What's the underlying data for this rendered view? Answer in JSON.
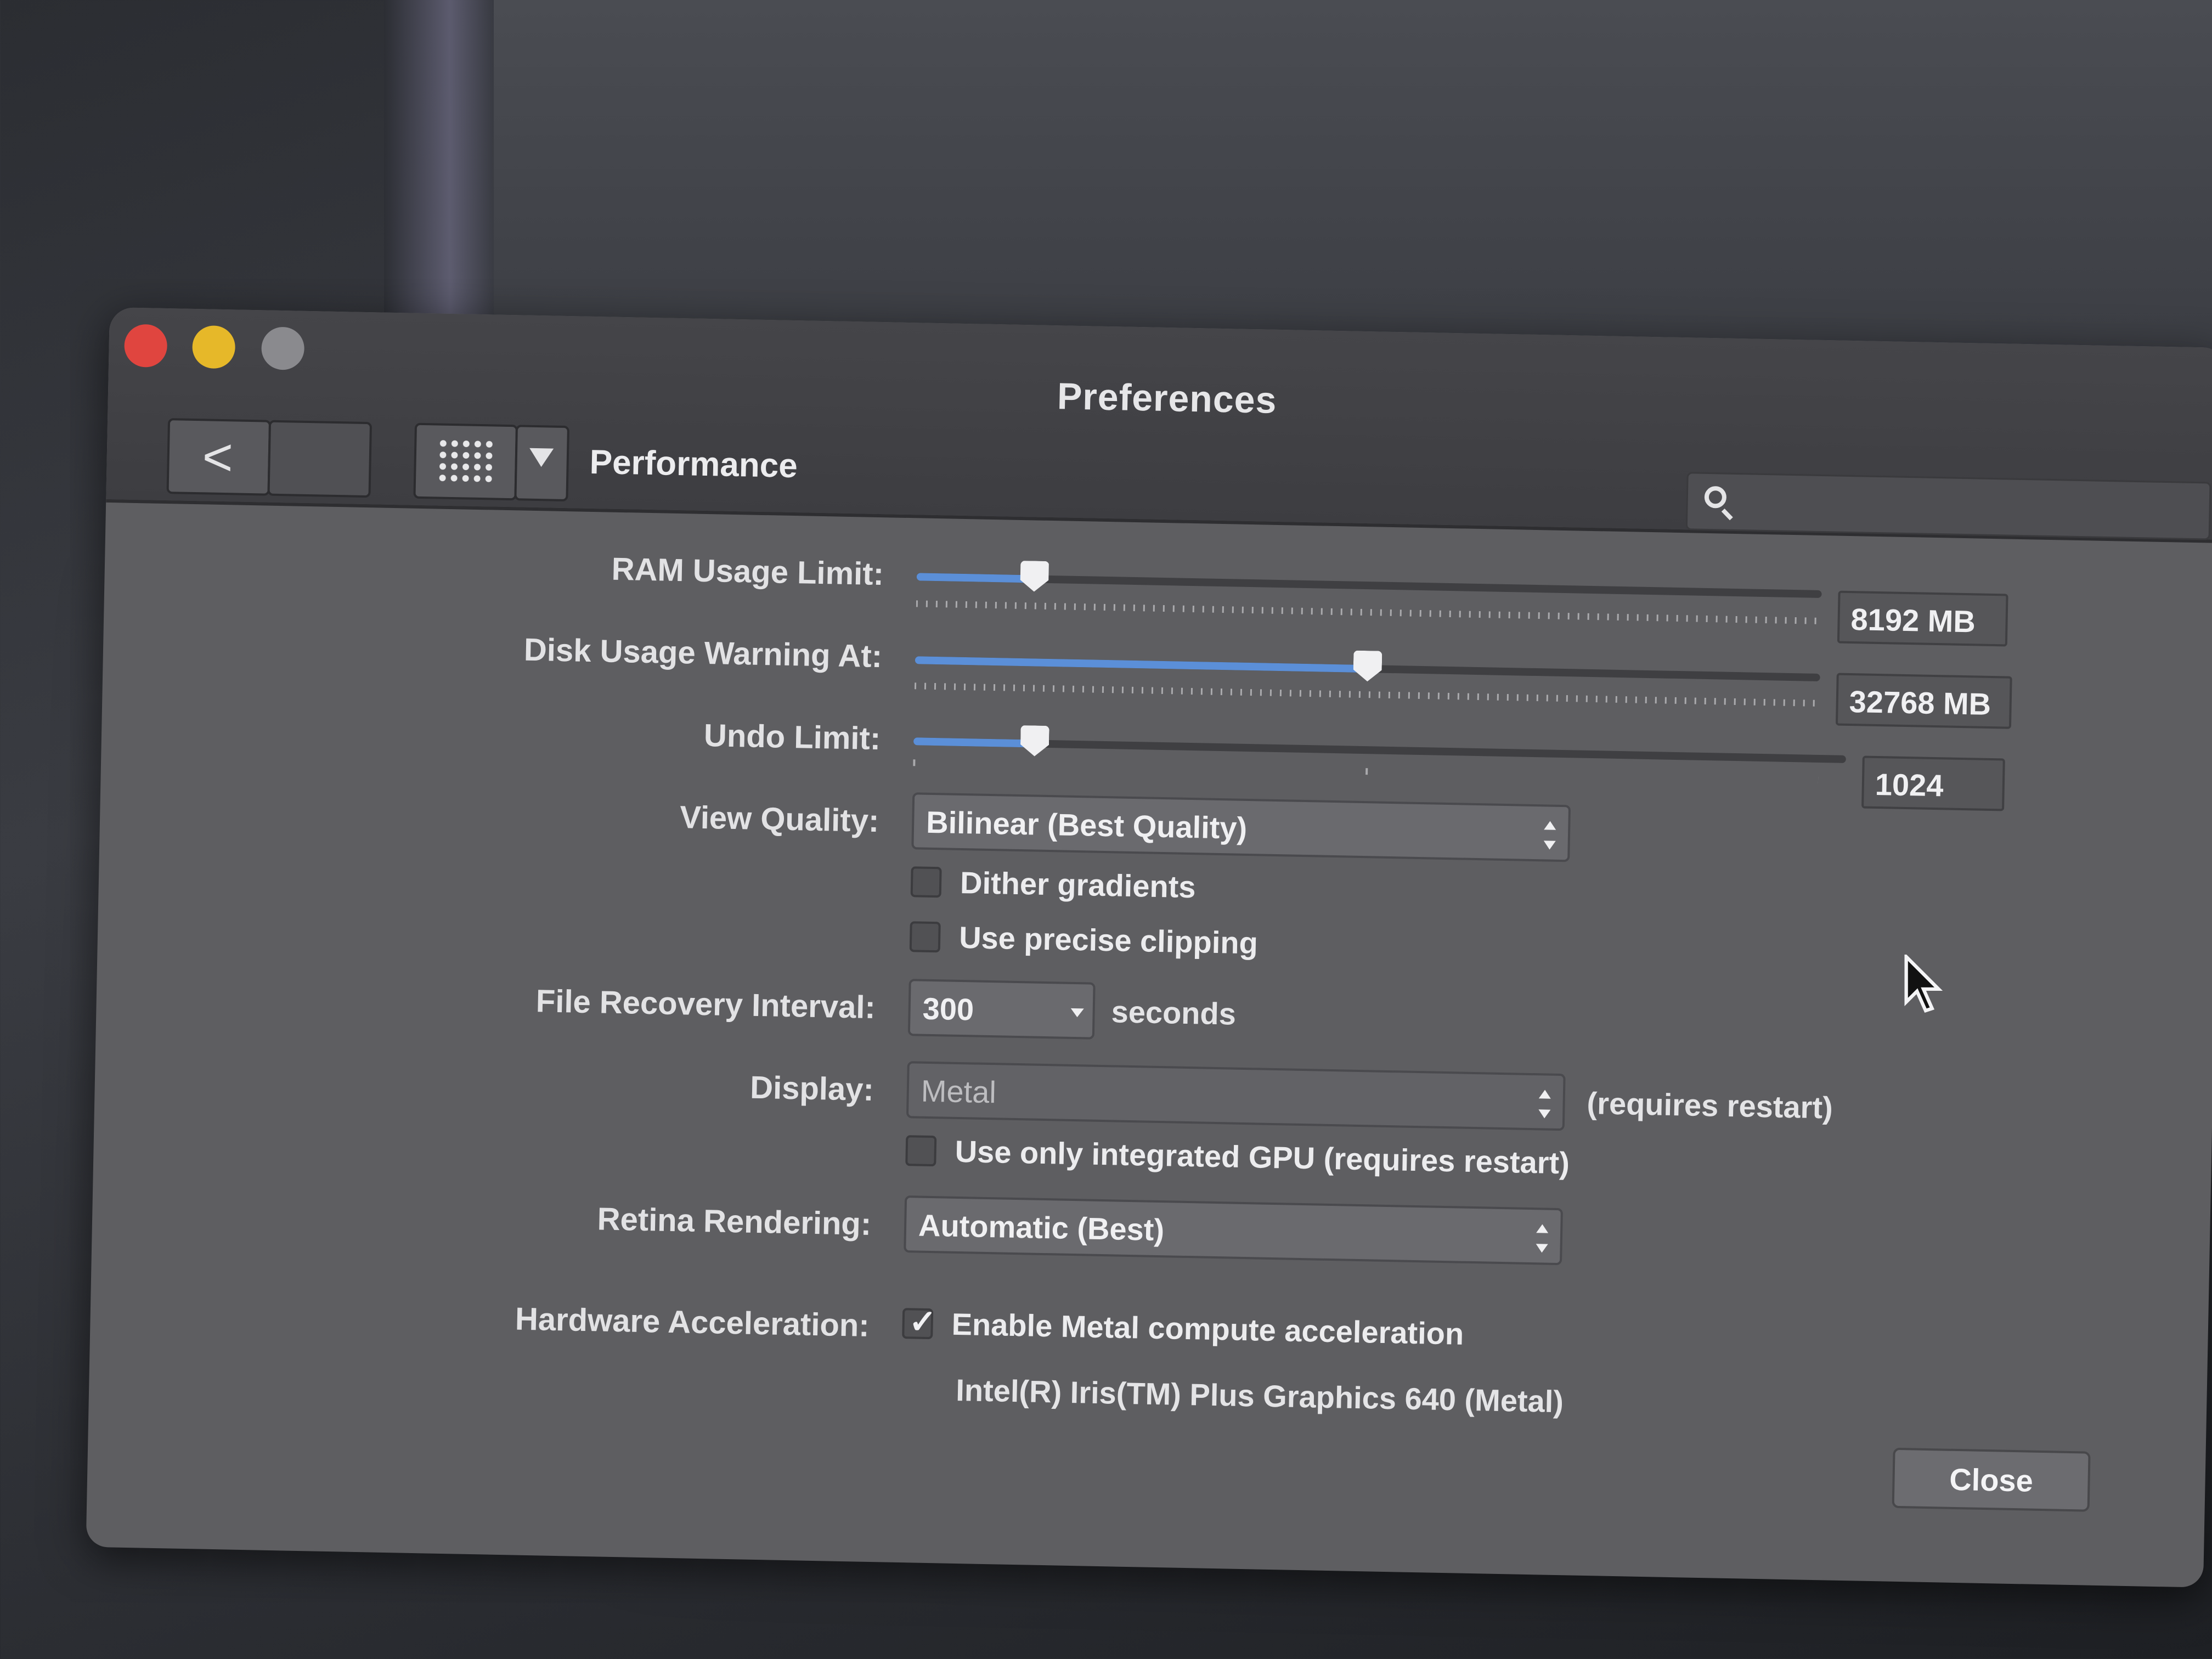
{
  "window": {
    "title": "Preferences",
    "section_title": "Performance"
  },
  "toolbar": {
    "back_icon": "chevron-left-icon",
    "grid_icon": "grid-icon",
    "dropdown_icon": "chevron-down-icon",
    "search_icon": "search-icon",
    "search_placeholder": ""
  },
  "ram": {
    "label": "RAM Usage Limit:",
    "value": "8192 MB",
    "level_fraction": 0.13
  },
  "disk": {
    "label": "Disk Usage Warning At:",
    "value": "32768 MB",
    "level_fraction": 0.5
  },
  "undo": {
    "label": "Undo Limit:",
    "value": "1024",
    "level_fraction": 0.13
  },
  "view_quality": {
    "label": "View Quality:",
    "selected": "Bilinear (Best Quality)"
  },
  "checkboxes": {
    "dither": {
      "label": "Dither gradients",
      "checked": false
    },
    "precise_clipping": {
      "label": "Use precise clipping",
      "checked": false
    },
    "integrated_gpu": {
      "label": "Use only integrated GPU (requires restart)",
      "checked": false
    },
    "metal_compute": {
      "label": "Enable Metal compute acceleration",
      "checked": true
    }
  },
  "file_recovery": {
    "label": "File Recovery Interval:",
    "value": "300",
    "unit": "seconds"
  },
  "display": {
    "label": "Display:",
    "selected": "Metal",
    "note": "(requires restart)"
  },
  "retina": {
    "label": "Retina Rendering:",
    "selected": "Automatic (Best)"
  },
  "hardware": {
    "label": "Hardware Acceleration:",
    "gpu_name": "Intel(R) Iris(TM) Plus Graphics 640 (Metal)"
  },
  "buttons": {
    "close": "Close"
  },
  "colors": {
    "slider_fill": "#5b8fd8",
    "close_traffic_light": "#e0453f",
    "minimize_traffic_light": "#e6b829",
    "zoom_traffic_light": "#8a8a8e"
  }
}
